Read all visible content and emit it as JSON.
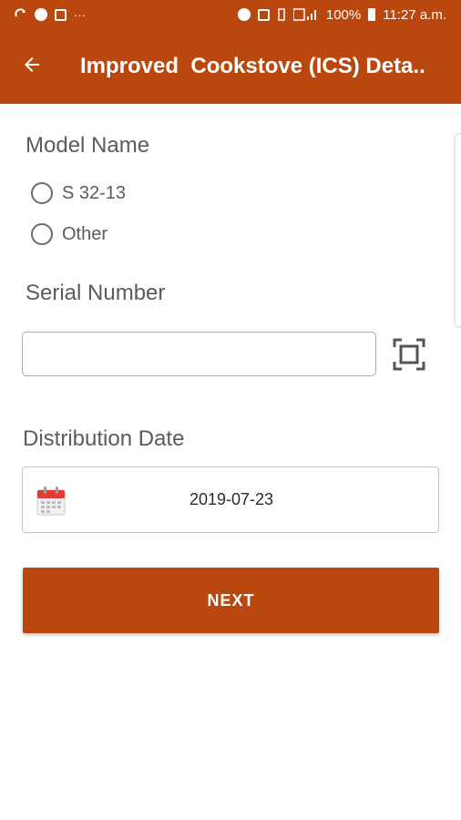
{
  "status_bar": {
    "battery": "100%",
    "time": "11:27 a.m.",
    "more": "···",
    "left_icons": [
      "sync-icon",
      "messenger-icon",
      "photo-icon",
      "more-icon"
    ],
    "right_icons": [
      "alarm-icon",
      "notification-badge-icon",
      "vibrate-icon",
      "signal-icon",
      "battery-icon"
    ]
  },
  "app_bar": {
    "title": "Improved  Cookstove (ICS) Deta.."
  },
  "model_name": {
    "label": "Model Name",
    "options": [
      "S 32-13",
      "Other"
    ]
  },
  "serial_number": {
    "label": "Serial Number",
    "value": "",
    "placeholder": ""
  },
  "distribution_date": {
    "label": "Distribution Date",
    "value": "2019-07-23"
  },
  "next_button": {
    "label": "NEXT"
  },
  "colors": {
    "primary": "#b9470e",
    "text": "#5b5b5b",
    "calendar_red": "#e53935"
  }
}
